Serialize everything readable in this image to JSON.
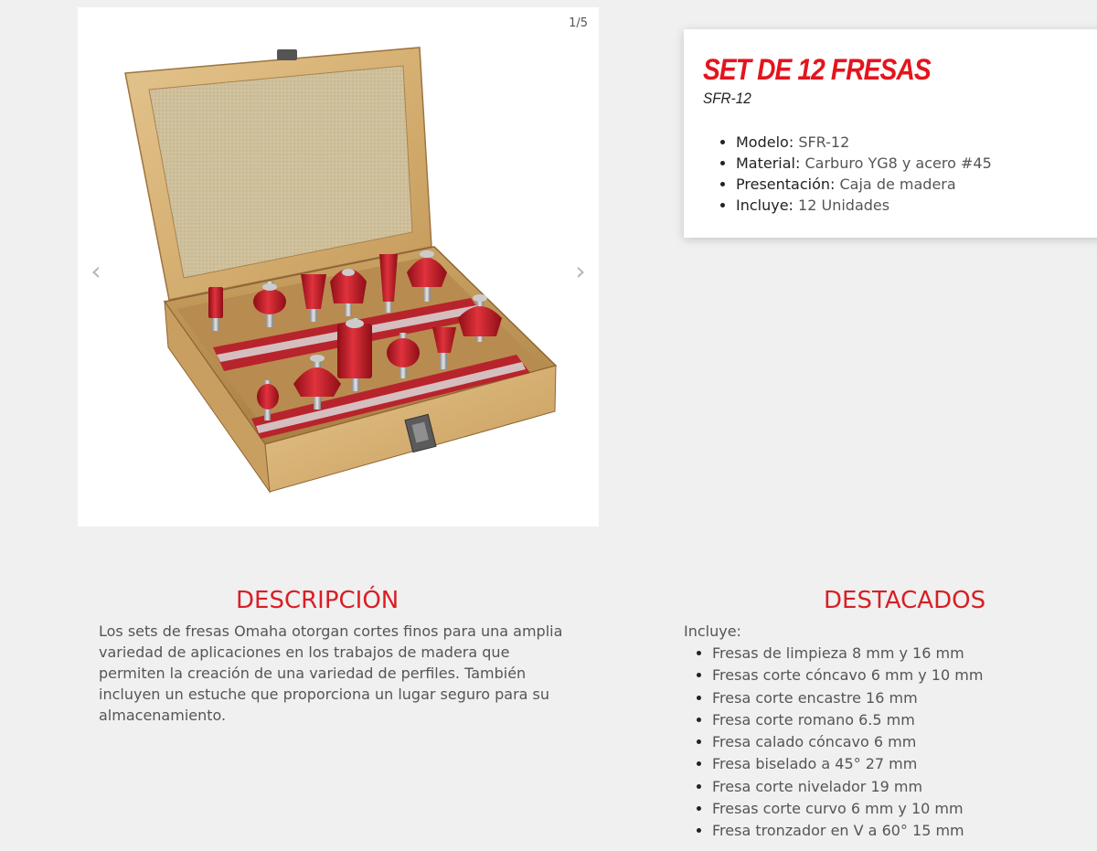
{
  "gallery": {
    "counter": "1/5",
    "prev_label": "‹",
    "next_label": "›",
    "image_alt": "Set de 12 fresas en caja de madera"
  },
  "product": {
    "title": "SET DE 12 FRESAS",
    "model_code": "SFR-12",
    "specs": [
      {
        "label": "Modelo:",
        "value": "SFR-12"
      },
      {
        "label": "Material:",
        "value": "Carburo YG8 y acero #45"
      },
      {
        "label": "Presentación:",
        "value": "Caja de madera"
      },
      {
        "label": "Incluye:",
        "value": "12 Unidades"
      }
    ]
  },
  "description": {
    "title": "DESCRIPCIÓN",
    "body": "Los sets de fresas Omaha otorgan cortes finos para una amplia variedad de aplicaciones en los trabajos de madera que permiten la creación de una variedad de perfiles. También incluyen un estuche que proporciona un lugar seguro para su almacenamiento."
  },
  "highlights": {
    "title": "DESTACADOS",
    "intro": "Incluye:",
    "items": [
      "Fresas de limpieza 8 mm y 16 mm",
      "Fresas corte cóncavo 6 mm y 10 mm",
      "Fresa corte encastre 16 mm",
      "Fresa corte romano 6.5 mm",
      "Fresa calado cóncavo 6 mm",
      "Fresa biselado a 45° 27 mm",
      "Fresa corte nivelador 19 mm",
      "Fresas corte curvo 6 mm y 10 mm",
      "Fresa tronzador en V a 60° 15 mm"
    ]
  },
  "colors": {
    "accent": "#e4141d",
    "heading": "#d81f26",
    "page_bg": "#f0f0f0"
  }
}
